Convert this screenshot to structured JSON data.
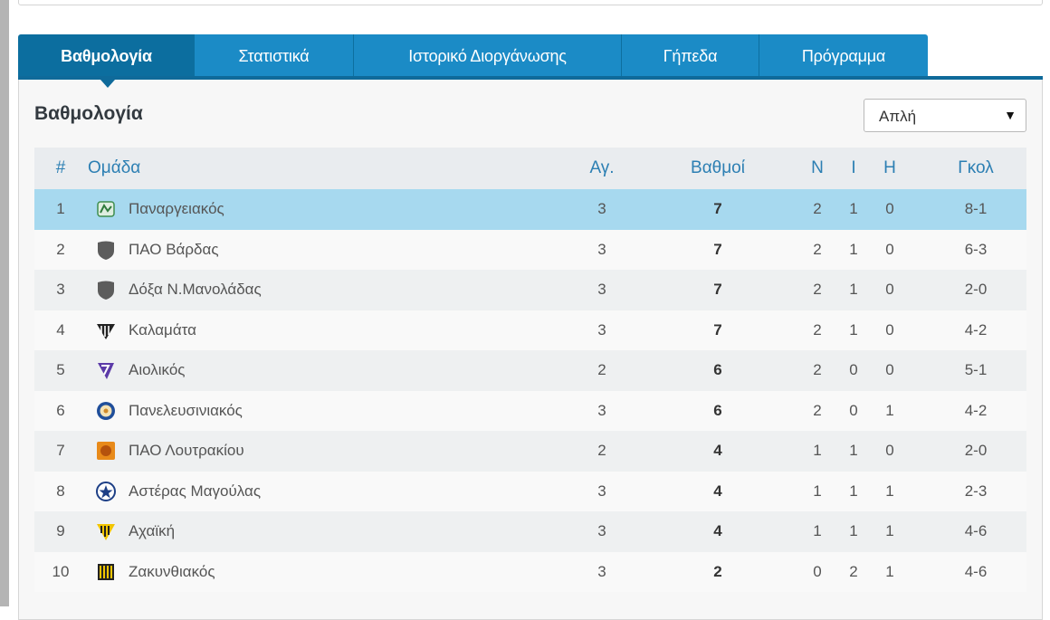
{
  "tabs": [
    {
      "label": "Βαθμολογία",
      "active": true
    },
    {
      "label": "Στατιστικά",
      "active": false
    },
    {
      "label": "Ιστορικό Διοργάνωσης",
      "active": false
    },
    {
      "label": "Γήπεδα",
      "active": false
    },
    {
      "label": "Πρόγραμμα",
      "active": false
    }
  ],
  "section_title": "Βαθμολογία",
  "view_select": {
    "value": "Απλή"
  },
  "table": {
    "headers": {
      "pos": "#",
      "team": "Ομάδα",
      "games": "Αγ.",
      "points": "Βαθμοί",
      "w": "Ν",
      "d": "Ι",
      "l": "Η",
      "goals": "Γκολ"
    },
    "rows": [
      {
        "pos": "1",
        "team": "Παναργειακός",
        "crest": "panargiakos-crest",
        "games": "3",
        "points": "7",
        "w": "2",
        "d": "1",
        "l": "0",
        "goals": "8-1",
        "highlight": true
      },
      {
        "pos": "2",
        "team": "ΠΑΟ Βάρδας",
        "crest": "generic-shield",
        "games": "3",
        "points": "7",
        "w": "2",
        "d": "1",
        "l": "0",
        "goals": "6-3"
      },
      {
        "pos": "3",
        "team": "Δόξα Ν.Μανολάδας",
        "crest": "generic-shield",
        "games": "3",
        "points": "7",
        "w": "2",
        "d": "1",
        "l": "0",
        "goals": "2-0"
      },
      {
        "pos": "4",
        "team": "Καλαμάτα",
        "crest": "kalamata-crest",
        "games": "3",
        "points": "7",
        "w": "2",
        "d": "1",
        "l": "0",
        "goals": "4-2"
      },
      {
        "pos": "5",
        "team": "Αιολικός",
        "crest": "aiolikos-crest",
        "games": "2",
        "points": "6",
        "w": "2",
        "d": "0",
        "l": "0",
        "goals": "5-1"
      },
      {
        "pos": "6",
        "team": "Πανελευσινιακός",
        "crest": "paneleusiniakos-crest",
        "games": "3",
        "points": "6",
        "w": "2",
        "d": "0",
        "l": "1",
        "goals": "4-2"
      },
      {
        "pos": "7",
        "team": "ΠΑΟ Λουτρακίου",
        "crest": "loutraki-crest",
        "games": "2",
        "points": "4",
        "w": "1",
        "d": "1",
        "l": "0",
        "goals": "2-0"
      },
      {
        "pos": "8",
        "team": "Αστέρας Μαγούλας",
        "crest": "asteras-crest",
        "games": "3",
        "points": "4",
        "w": "1",
        "d": "1",
        "l": "1",
        "goals": "2-3"
      },
      {
        "pos": "9",
        "team": "Αχαϊκή",
        "crest": "achaiki-crest",
        "games": "3",
        "points": "4",
        "w": "1",
        "d": "1",
        "l": "1",
        "goals": "4-6"
      },
      {
        "pos": "10",
        "team": "Ζακυνθιακός",
        "crest": "zakynthiakos-crest",
        "games": "3",
        "points": "2",
        "w": "0",
        "d": "2",
        "l": "1",
        "goals": "4-6"
      }
    ]
  },
  "colors": {
    "tab_bg": "#1b8bc6",
    "tab_active": "#0c6e9f",
    "header_text": "#2c7fb3",
    "highlight_row": "#a7d9ef"
  }
}
